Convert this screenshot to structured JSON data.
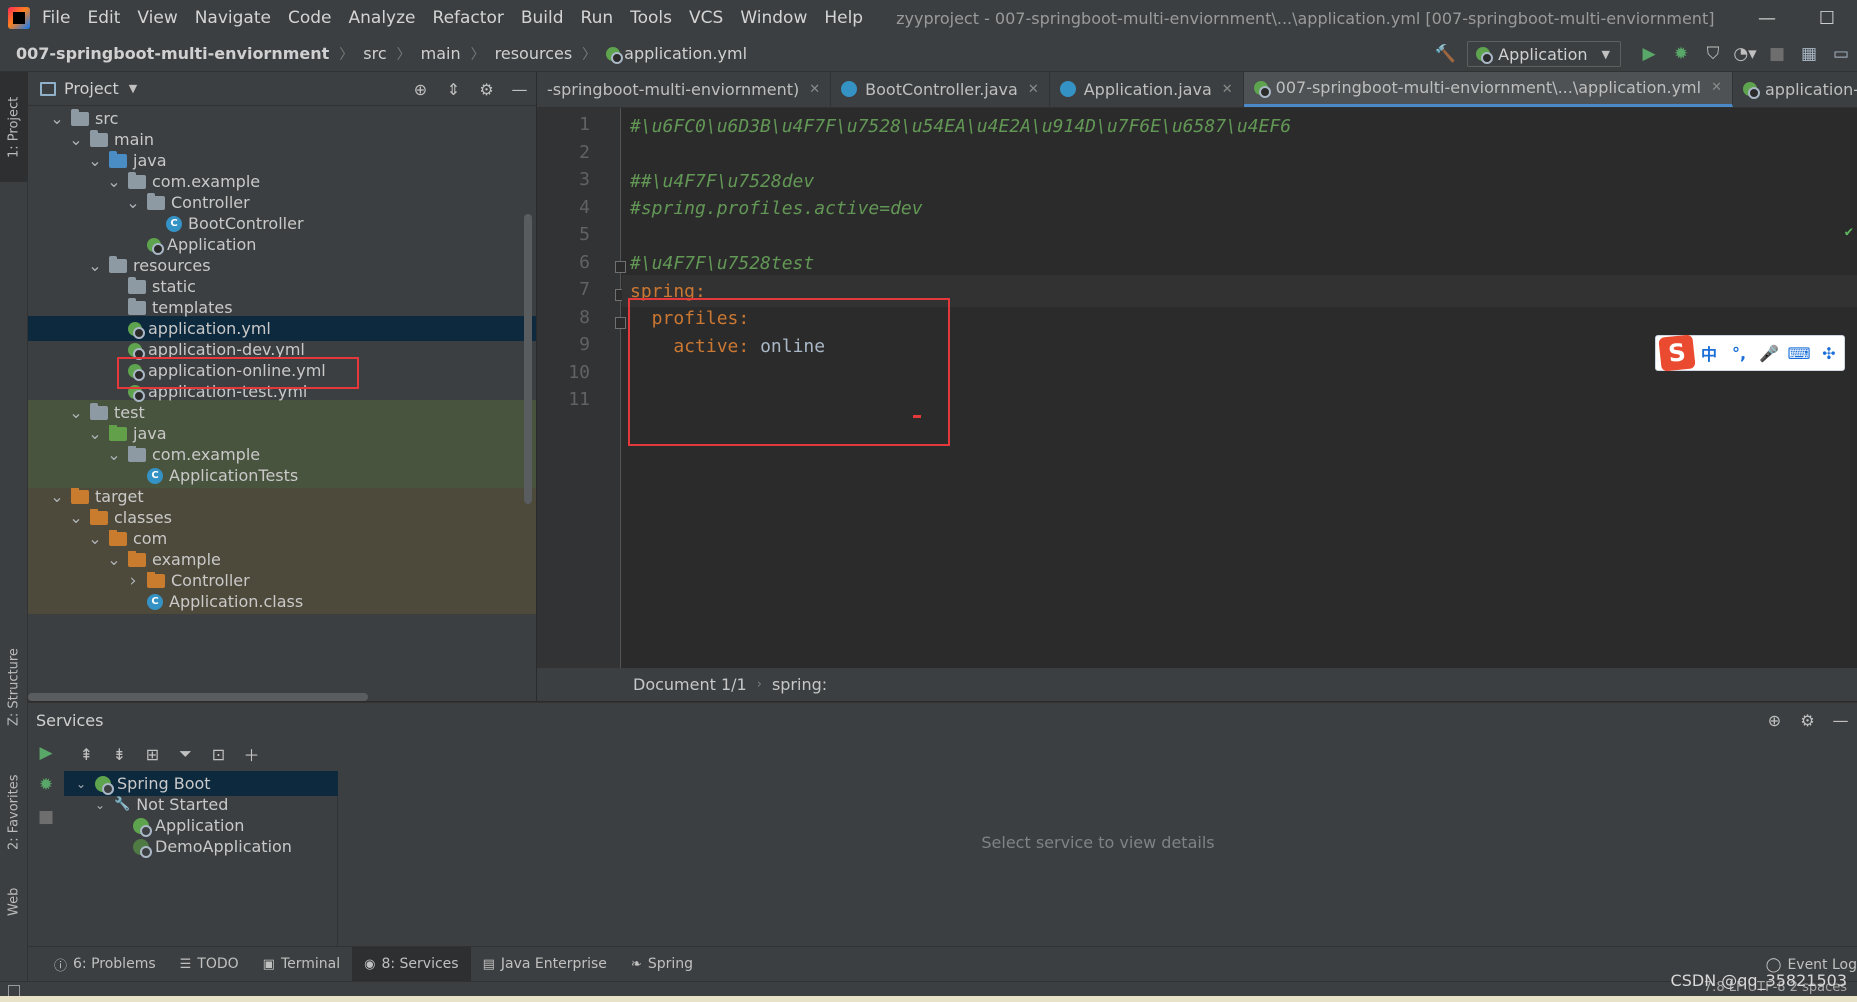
{
  "menu": {
    "items": [
      "File",
      "Edit",
      "View",
      "Navigate",
      "Code",
      "Analyze",
      "Refactor",
      "Build",
      "Run",
      "Tools",
      "VCS",
      "Window",
      "Help"
    ],
    "window_title": "zyyproject - 007-springboot-multi-enviornment\\...\\application.yml [007-springboot-multi-enviornment]"
  },
  "breadcrumb": [
    "007-springboot-multi-enviornment",
    "src",
    "main",
    "resources",
    "application.yml"
  ],
  "run_config": {
    "label": "Application"
  },
  "project_panel": {
    "title": "Project",
    "tree": [
      {
        "label": "src",
        "indent": 1,
        "chevron": "down",
        "icon": "folder-grey"
      },
      {
        "label": "main",
        "indent": 2,
        "chevron": "down",
        "icon": "folder-grey"
      },
      {
        "label": "java",
        "indent": 3,
        "chevron": "down",
        "icon": "folder-blue"
      },
      {
        "label": "com.example",
        "indent": 4,
        "chevron": "down",
        "icon": "folder-grey"
      },
      {
        "label": "Controller",
        "indent": 5,
        "chevron": "down",
        "icon": "folder-grey"
      },
      {
        "label": "BootController",
        "indent": 6,
        "chevron": "",
        "icon": "class"
      },
      {
        "label": "Application",
        "indent": 5,
        "chevron": "",
        "icon": "boot"
      },
      {
        "label": "resources",
        "indent": 3,
        "chevron": "down",
        "icon": "folder-grey"
      },
      {
        "label": "static",
        "indent": 4,
        "chevron": "",
        "icon": "folder-grey"
      },
      {
        "label": "templates",
        "indent": 4,
        "chevron": "",
        "icon": "folder-grey"
      },
      {
        "label": "application.yml",
        "indent": 4,
        "chevron": "",
        "icon": "yml",
        "selected": true
      },
      {
        "label": "application-dev.yml",
        "indent": 4,
        "chevron": "",
        "icon": "yml"
      },
      {
        "label": "application-online.yml",
        "indent": 4,
        "chevron": "",
        "icon": "yml"
      },
      {
        "label": "application-test.yml",
        "indent": 4,
        "chevron": "",
        "icon": "yml"
      },
      {
        "label": "test",
        "indent": 2,
        "chevron": "down",
        "icon": "folder-grey",
        "bg": "test"
      },
      {
        "label": "java",
        "indent": 3,
        "chevron": "down",
        "icon": "folder-green",
        "bg": "test"
      },
      {
        "label": "com.example",
        "indent": 4,
        "chevron": "down",
        "icon": "folder-grey",
        "bg": "test"
      },
      {
        "label": "ApplicationTests",
        "indent": 5,
        "chevron": "",
        "icon": "class",
        "bg": "test"
      },
      {
        "label": "target",
        "indent": 1,
        "chevron": "down",
        "icon": "folder-orange",
        "bg": "target"
      },
      {
        "label": "classes",
        "indent": 2,
        "chevron": "down",
        "icon": "folder-orange",
        "bg": "target"
      },
      {
        "label": "com",
        "indent": 3,
        "chevron": "down",
        "icon": "folder-orange",
        "bg": "target"
      },
      {
        "label": "example",
        "indent": 4,
        "chevron": "down",
        "icon": "folder-orange",
        "bg": "target"
      },
      {
        "label": "Controller",
        "indent": 5,
        "chevron": "right",
        "icon": "folder-orange",
        "bg": "target"
      },
      {
        "label": "Application.class",
        "indent": 5,
        "chevron": "",
        "icon": "class",
        "bg": "target"
      }
    ]
  },
  "editor": {
    "tabs": [
      {
        "label": "-springboot-multi-enviornment)",
        "icon": "none"
      },
      {
        "label": "BootController.java",
        "icon": "java"
      },
      {
        "label": "Application.java",
        "icon": "java"
      },
      {
        "label": "007-springboot-multi-enviornment\\...\\application.yml",
        "icon": "yml",
        "active": true
      },
      {
        "label": "application-dev.yml",
        "icon": "yml"
      }
    ],
    "lines": [
      {
        "n": "1",
        "tokens": [
          {
            "t": "#\\u6FC0\\u6D3B\\u4F7F\\u7528\\u54EA\\u4E2A\\u914D\\u7F6E\\u6587\\u4EF6",
            "c": "cmt"
          }
        ]
      },
      {
        "n": "2",
        "tokens": []
      },
      {
        "n": "3",
        "tokens": [
          {
            "t": "##\\u4F7F\\u7528dev",
            "c": "cmt"
          }
        ]
      },
      {
        "n": "4",
        "tokens": [
          {
            "t": "#spring.profiles.active=dev",
            "c": "cmt"
          }
        ]
      },
      {
        "n": "5",
        "tokens": []
      },
      {
        "n": "6",
        "tokens": [
          {
            "t": "#\\u4F7F\\u7528test",
            "c": "cmt"
          }
        ]
      },
      {
        "n": "7",
        "tokens": [
          {
            "t": "spring",
            "c": "key"
          },
          {
            "t": ":",
            "c": "punct"
          }
        ],
        "current": true
      },
      {
        "n": "8",
        "tokens": [
          {
            "t": "  profiles",
            "c": "key"
          },
          {
            "t": ":",
            "c": "punct"
          }
        ]
      },
      {
        "n": "9",
        "tokens": [
          {
            "t": "    active",
            "c": "key"
          },
          {
            "t": ": ",
            "c": "punct"
          },
          {
            "t": "online",
            "c": "val"
          }
        ]
      },
      {
        "n": "10",
        "tokens": []
      },
      {
        "n": "11",
        "tokens": []
      }
    ],
    "breadcrumb": [
      "Document 1/1",
      "spring:"
    ]
  },
  "ime": {
    "logo": "S",
    "items": [
      "中",
      "°,",
      "🎤",
      "⌨",
      "✣"
    ]
  },
  "services": {
    "title": "Services",
    "tree": [
      {
        "label": "Spring Boot",
        "indent": 1,
        "chevron": "down",
        "icon": "boot",
        "selected": true
      },
      {
        "label": "Not Started",
        "indent": 2,
        "chevron": "down",
        "icon": "wrench"
      },
      {
        "label": "Application",
        "indent": 3,
        "chevron": "",
        "icon": "boot"
      },
      {
        "label": "DemoApplication",
        "indent": 3,
        "chevron": "",
        "icon": "boot-dim"
      }
    ],
    "empty_text": "Select service to view details"
  },
  "left_strip": {
    "project": "1: Project",
    "structure": "Z: Structure",
    "favorites": "2: Favorites",
    "web": "Web"
  },
  "bottom_tabs": [
    {
      "label": "6: Problems",
      "icon": "ⓘ"
    },
    {
      "label": "TODO",
      "icon": "☰"
    },
    {
      "label": "Terminal",
      "icon": "▣"
    },
    {
      "label": "8: Services",
      "icon": "◉",
      "active": true
    },
    {
      "label": "Java Enterprise",
      "icon": "▤"
    },
    {
      "label": "Spring",
      "icon": "❧"
    }
  ],
  "event_log": "Event Log",
  "status_right": "7:8  LF  UTF-8  2 spaces",
  "watermark": "CSDN @qq_35821503"
}
